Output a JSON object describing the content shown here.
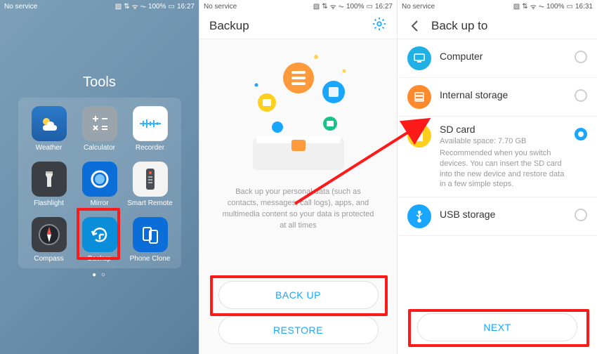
{
  "status": {
    "carrier": "No service",
    "time1": "16:27",
    "time2": "16:27",
    "time3": "16:31",
    "battery": "100%",
    "icons": "⃞ ⇅ ᯤ ⏦"
  },
  "panel1": {
    "folder_title": "Tools",
    "apps": [
      {
        "key": "weather",
        "label": "Weather"
      },
      {
        "key": "calculator",
        "label": "Calculator"
      },
      {
        "key": "recorder",
        "label": "Recorder"
      },
      {
        "key": "flashlight",
        "label": "Flashlight"
      },
      {
        "key": "mirror",
        "label": "Mirror"
      },
      {
        "key": "smartremote",
        "label": "Smart Remote"
      },
      {
        "key": "compass",
        "label": "Compass"
      },
      {
        "key": "backup",
        "label": "Backup"
      },
      {
        "key": "phoneclone",
        "label": "Phone Clone"
      }
    ]
  },
  "panel2": {
    "title": "Backup",
    "description": "Back up your personal data (such as contacts, messages, call logs), apps, and multimedia content so your data is protected at all times",
    "backup_btn": "BACK UP",
    "restore_btn": "RESTORE"
  },
  "panel3": {
    "title": "Back up to",
    "options": {
      "computer": "Computer",
      "internal": "Internal storage",
      "sd": "SD card",
      "sd_space": "Available space: 7.70 GB",
      "sd_desc": "Recommended when you switch devices. You can insert the SD card into the new device and restore data in a few simple steps.",
      "usb": "USB storage"
    },
    "next_btn": "NEXT"
  }
}
